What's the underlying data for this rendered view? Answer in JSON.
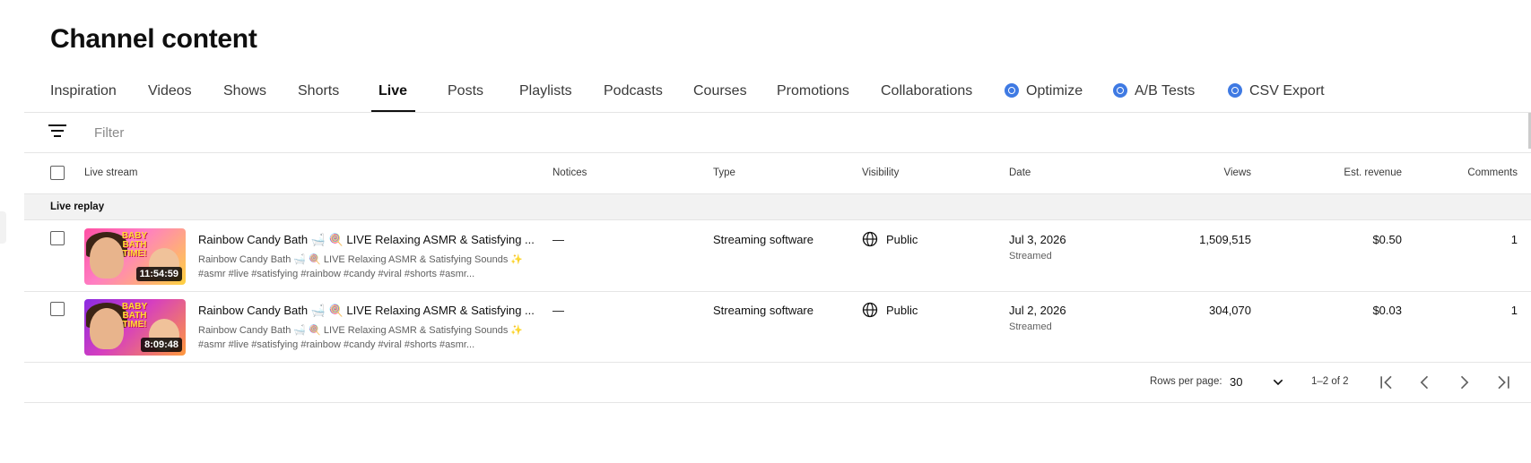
{
  "page": {
    "title": "Channel content"
  },
  "tabs": [
    {
      "label": "Inspiration"
    },
    {
      "label": "Videos"
    },
    {
      "label": "Shows"
    },
    {
      "label": "Shorts"
    },
    {
      "label": "Live",
      "active": true
    },
    {
      "label": "Posts"
    },
    {
      "label": "Playlists"
    },
    {
      "label": "Podcasts"
    },
    {
      "label": "Courses"
    },
    {
      "label": "Promotions"
    },
    {
      "label": "Collaborations"
    },
    {
      "label": "Optimize",
      "icon": "extension-icon"
    },
    {
      "label": "A/B Tests",
      "icon": "extension-icon"
    },
    {
      "label": "CSV Export",
      "icon": "extension-icon"
    }
  ],
  "filter": {
    "placeholder": "Filter",
    "icon": "filter-icon"
  },
  "columns": {
    "live_stream": "Live stream",
    "notices": "Notices",
    "type": "Type",
    "visibility": "Visibility",
    "date": "Date",
    "views": "Views",
    "revenue": "Est. revenue",
    "comments": "Comments"
  },
  "group": {
    "label": "Live replay"
  },
  "rows": [
    {
      "title": "Rainbow Candy Bath 🛁 🍭 LIVE Relaxing ASMR & Satisfying ...",
      "desc1": "Rainbow Candy Bath 🛁 🍭 LIVE Relaxing ASMR & Satisfying Sounds ✨",
      "desc2": "#asmr #live #satisfying #rainbow #candy #viral #shorts #asmr...",
      "duration": "11:54:59",
      "thumb_text": "BABY BATH TIME!",
      "notices": "—",
      "type": "Streaming software",
      "visibility": "Public",
      "date": "Jul 3, 2026",
      "date_sub": "Streamed",
      "views": "1,509,515",
      "revenue": "$0.50",
      "comments": "1"
    },
    {
      "title": "Rainbow Candy Bath 🛁 🍭 LIVE Relaxing ASMR & Satisfying ...",
      "desc1": "Rainbow Candy Bath 🛁 🍭 LIVE Relaxing ASMR & Satisfying Sounds ✨",
      "desc2": "#asmr #live #satisfying #rainbow #candy #viral #shorts #asmr...",
      "duration": "8:09:48",
      "thumb_text": "BABY BATH TIME!",
      "notices": "—",
      "type": "Streaming software",
      "visibility": "Public",
      "date": "Jul 2, 2026",
      "date_sub": "Streamed",
      "views": "304,070",
      "revenue": "$0.03",
      "comments": "1"
    }
  ],
  "pagination": {
    "rows_per_page_label": "Rows per page:",
    "rows_per_page": "30",
    "range": "1–2 of 2"
  },
  "colors": {
    "accent_icon": "#3f7ae3",
    "group_bg": "#f2f2f2",
    "divider": "#e5e5e5"
  }
}
